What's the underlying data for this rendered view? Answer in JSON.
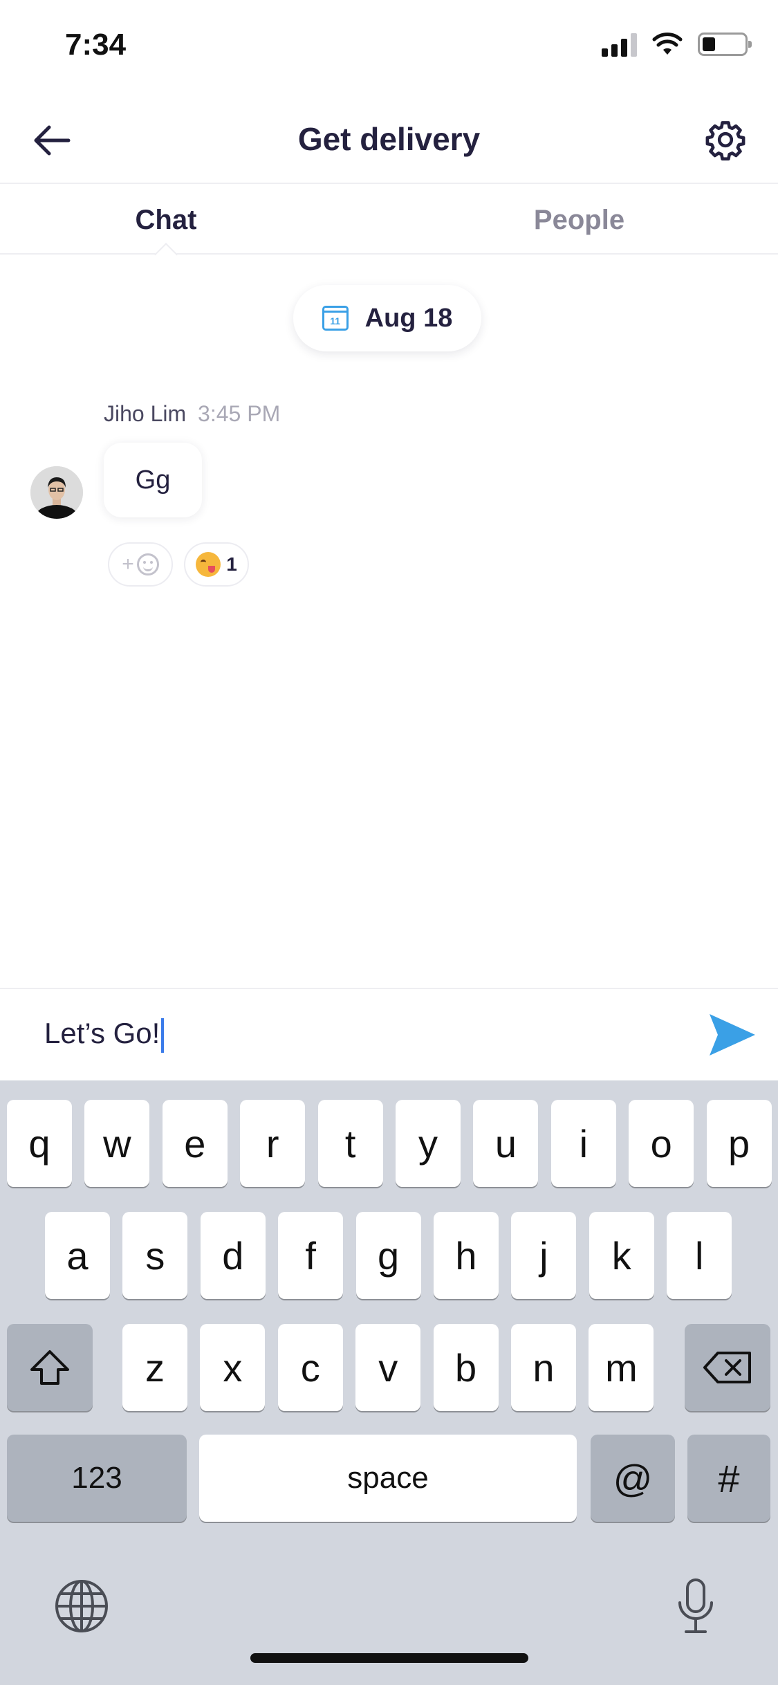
{
  "status_bar": {
    "time": "7:34"
  },
  "header": {
    "title": "Get delivery"
  },
  "tabs": [
    {
      "label": "Chat",
      "active": true
    },
    {
      "label": "People",
      "active": false
    }
  ],
  "date_pill": {
    "calendar_day": "11",
    "label": "Aug 18"
  },
  "message": {
    "author": "Jiho Lim",
    "time": "3:45 PM",
    "text": "Gg",
    "reactions": [
      {
        "emoji_icon": "yum-emoji",
        "count": "1"
      }
    ],
    "add_reaction_label": "+"
  },
  "composer": {
    "value": "Let’s Go!"
  },
  "keyboard": {
    "row1": [
      "q",
      "w",
      "e",
      "r",
      "t",
      "y",
      "u",
      "i",
      "o",
      "p"
    ],
    "row2": [
      "a",
      "s",
      "d",
      "f",
      "g",
      "h",
      "j",
      "k",
      "l"
    ],
    "row3": [
      "z",
      "x",
      "c",
      "v",
      "b",
      "n",
      "m"
    ],
    "numbers_label": "123",
    "space_label": "space",
    "at_label": "@",
    "hash_label": "#"
  },
  "colors": {
    "accent": "#3aa0e6",
    "title": "#24213f",
    "muted": "#8a8898",
    "keyboard_bg": "#d2d6de"
  }
}
